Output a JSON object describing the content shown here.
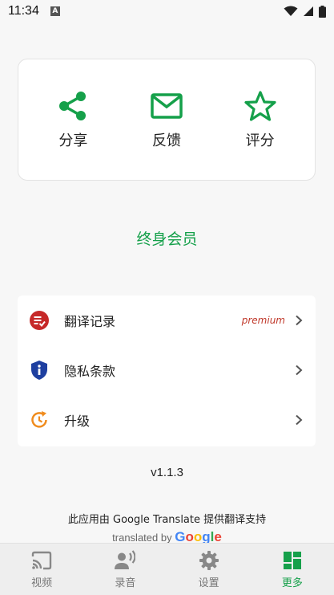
{
  "status_bar": {
    "time": "11:34",
    "badge": "A"
  },
  "share_card": {
    "items": [
      {
        "label": "分享",
        "icon": "share-icon"
      },
      {
        "label": "反馈",
        "icon": "mail-icon"
      },
      {
        "label": "评分",
        "icon": "star-icon"
      }
    ]
  },
  "member_link": "终身会员",
  "menu": {
    "items": [
      {
        "label": "翻译记录",
        "icon": "history-icon",
        "badge": "premium"
      },
      {
        "label": "隐私条款",
        "icon": "privacy-shield-icon"
      },
      {
        "label": "升级",
        "icon": "update-icon"
      }
    ]
  },
  "version": "v1.1.3",
  "credit": "此应用由 Google Translate 提供翻译支持",
  "translated_by": {
    "prefix": "translated by",
    "brand": "Google"
  },
  "bottom_nav": {
    "items": [
      {
        "label": "视频",
        "icon": "cast-icon"
      },
      {
        "label": "录音",
        "icon": "voice-icon"
      },
      {
        "label": "设置",
        "icon": "gear-icon"
      },
      {
        "label": "更多",
        "icon": "dashboard-icon",
        "active": true
      }
    ]
  },
  "colors": {
    "accent": "#15a04a",
    "history": "#c62828",
    "privacy": "#1e3fa0",
    "update": "#f08c1e"
  }
}
